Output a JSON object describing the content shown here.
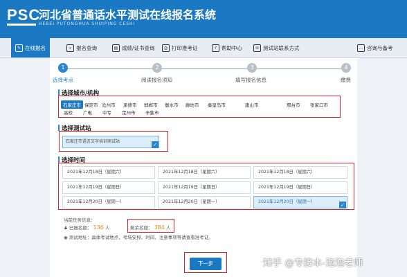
{
  "header": {
    "logo": "PSC",
    "title": "河北省普通话水平测试在线报名系统",
    "subtitle": "HEBEI PUTONGHUA SHUIPING CESHI"
  },
  "nav": [
    {
      "label": "在线报名",
      "icon": "edit-icon",
      "active": true
    },
    {
      "label": "报名查询",
      "icon": "search-icon"
    },
    {
      "label": "成绩/证书查询",
      "icon": "certificate-icon"
    },
    {
      "label": "打印准考证",
      "icon": "printer-icon"
    },
    {
      "label": "帮助中心",
      "icon": "help-icon"
    },
    {
      "label": "测试站联系方式",
      "icon": "contact-icon"
    },
    {
      "label": "咨询与备考",
      "icon": "chat-icon"
    }
  ],
  "steps": [
    {
      "num": "1",
      "label": "选择考点",
      "active": true
    },
    {
      "num": "2",
      "label": "阅读报名须知"
    },
    {
      "num": "3",
      "label": "填写报名信息"
    },
    {
      "num": "4",
      "label": "缴费"
    }
  ],
  "city_section": {
    "title": "选择城市/机构",
    "row1": [
      "石家庄市",
      "保定市",
      "沧州市",
      "承德市",
      "邯郸市",
      "衡水市",
      "廊坊市",
      "秦皇岛市",
      "唐山市",
      "邢台市",
      "张家口市"
    ],
    "row2": [
      "高校",
      "广电",
      "中专",
      "定州市",
      "辛集市"
    ],
    "selected": "石家庄市"
  },
  "site_section": {
    "title": "选择测试站",
    "site": "石家庄市语言文字培训测试站"
  },
  "time_section": {
    "title": "选择时间",
    "slots": [
      "2021年12月18日（星期六）",
      "2021年12月18日（星期六）",
      "2021年12月18日（星期六）",
      "2021年12月19日（星期日）",
      "2021年12月19日（星期日）",
      "2021年12月19日（星期日）",
      "2021年12月20日（星期一）",
      "2021年12月20日（星期一）",
      "2021年12月20日（星期一）"
    ],
    "selected_index": 8
  },
  "info": {
    "heading": "当前任务信息：",
    "registered_label": "已报名额：",
    "registered_value": "136",
    "registered_unit": "人",
    "remaining_label": "剩余名额：",
    "remaining_value": "384",
    "remaining_unit": "人",
    "address": "测试地址：具体考试地点、考场安排、时间、注意事项等请查看准考证。"
  },
  "next_button": "下一步",
  "watermark": "知乎 @专接本-泡泡老师",
  "colors": {
    "brand": "#1b78c2",
    "highlight": "#e0232b",
    "count": "#f08a16"
  }
}
